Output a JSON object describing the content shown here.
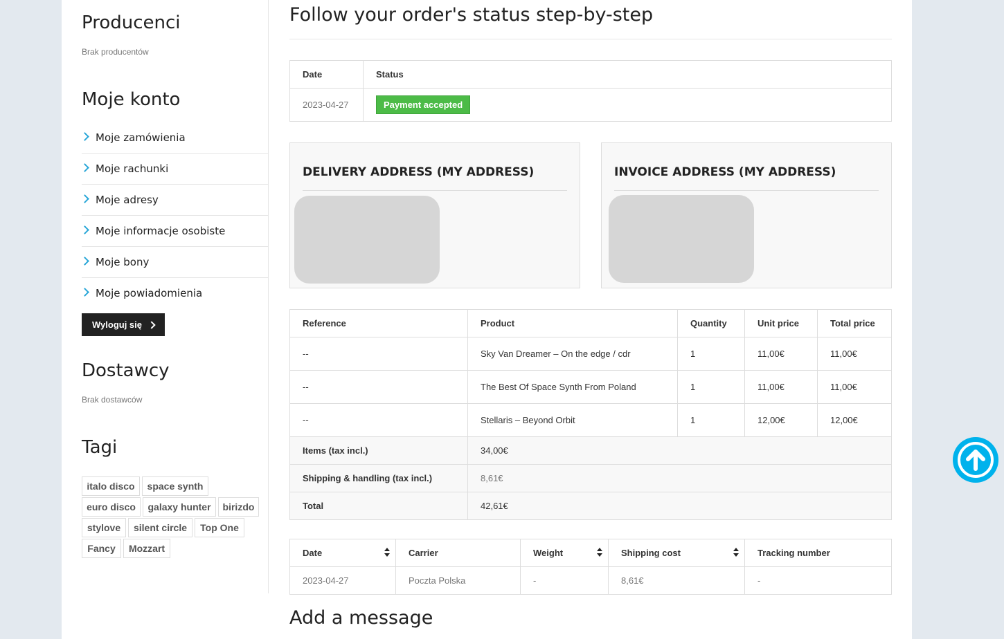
{
  "sidebar": {
    "producers": {
      "title": "Producenci",
      "empty": "Brak producentów"
    },
    "account": {
      "title": "Moje konto",
      "items": [
        {
          "label": "Moje zamówienia"
        },
        {
          "label": "Moje rachunki"
        },
        {
          "label": "Moje adresy"
        },
        {
          "label": "Moje informacje osobiste"
        },
        {
          "label": "Moje bony"
        },
        {
          "label": "Moje powiadomienia"
        }
      ],
      "logout_label": "Wyloguj się"
    },
    "suppliers": {
      "title": "Dostawcy",
      "empty": "Brak dostawców"
    },
    "tags": {
      "title": "Tagi",
      "items": [
        "italo disco",
        "space synth",
        "euro disco",
        "galaxy hunter",
        "birizdo",
        "stylove",
        "silent circle",
        "Top One",
        "Fancy",
        "Mozzart"
      ]
    }
  },
  "main": {
    "title": "Follow your order's status step-by-step",
    "status_table": {
      "headers": [
        "Date",
        "Status"
      ],
      "rows": [
        {
          "date": "2023-04-27",
          "status": "Payment accepted"
        }
      ]
    },
    "delivery_address": {
      "title": "DELIVERY ADDRESS (MY ADDRESS)"
    },
    "invoice_address": {
      "title": "INVOICE ADDRESS (MY ADDRESS)"
    },
    "products_table": {
      "headers": [
        "Reference",
        "Product",
        "Quantity",
        "Unit price",
        "Total price"
      ],
      "rows": [
        {
          "reference": "--",
          "product": "Sky Van Dreamer – On the edge / cdr",
          "quantity": "1",
          "unit_price": "11,00€",
          "total_price": "11,00€"
        },
        {
          "reference": "--",
          "product": "The Best Of Space Synth From Poland",
          "quantity": "1",
          "unit_price": "11,00€",
          "total_price": "11,00€"
        },
        {
          "reference": "--",
          "product": "Stellaris – Beyond Orbit",
          "quantity": "1",
          "unit_price": "12,00€",
          "total_price": "12,00€"
        }
      ],
      "summary": [
        {
          "label": "Items (tax incl.)",
          "value": "34,00€"
        },
        {
          "label": "Shipping & handling (tax incl.)",
          "value": "8,61€"
        },
        {
          "label": "Total",
          "value": "42,61€"
        }
      ]
    },
    "shipping_table": {
      "headers": [
        "Date",
        "Carrier",
        "Weight",
        "Shipping cost",
        "Tracking number"
      ],
      "rows": [
        {
          "date": "2023-04-27",
          "carrier": "Poczta Polska",
          "weight": "-",
          "shipping_cost": "8,61€",
          "tracking": "-"
        }
      ]
    },
    "add_message_title": "Add a message"
  },
  "colors": {
    "accent": "#00b2ec",
    "status_green": "#4cbb47",
    "chevron": "#2aa7d8"
  },
  "icons": {
    "scroll_top": "arrow-up-circle-icon",
    "menu_chevron": "chevron-right-icon"
  }
}
